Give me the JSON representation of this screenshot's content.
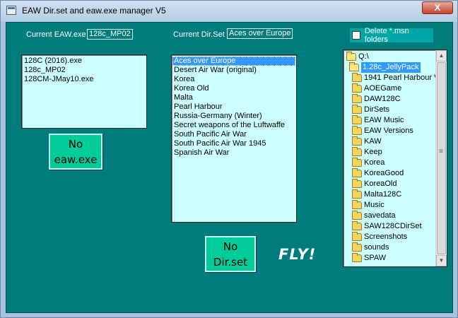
{
  "window": {
    "title": "EAW Dir.set and eaw.exe manager V5",
    "close_label": "X"
  },
  "current_exe": {
    "label": "Current EAW.exe",
    "value": "128c_MP02"
  },
  "current_dirset": {
    "label": "Current Dir.Set",
    "value": "Aces over Europe"
  },
  "delete_msn": {
    "label": "Delete *.msn folders",
    "checked": false
  },
  "exe_list": {
    "items": [
      "128C (2016).exe",
      "128c_MP02",
      "128CM-JMay10.exe"
    ]
  },
  "dirset_list": {
    "selected_index": 0,
    "items": [
      "Aces over Europe",
      "Desert Air War (original)",
      "Korea",
      "Korea Old",
      "Malta",
      "Pearl Harbour",
      "Russia-Germany (Winter)",
      "Secret weapons of the Luftwaffe",
      "South Pacific Air War",
      "South Pacific Air War 1945",
      "Spanish Air War"
    ]
  },
  "buttons": {
    "no_exe_line1": "No",
    "no_exe_line2": "eaw.exe",
    "no_dirset_line1": "No",
    "no_dirset_line2": "Dir.set",
    "fly": "FLY!"
  },
  "folder_tree": {
    "root": "Q:\\",
    "selected": "1.28c_JellyPack",
    "children": [
      "1941 Pearl Harbour V",
      "AOEGame",
      "DAW128C",
      "DirSets",
      "EAW Music",
      "EAW Versions",
      "KAW",
      "Keep",
      "Korea",
      "KoreaGood",
      "KoreaOld",
      "Malta128C",
      "Music",
      "savedata",
      "SAW128CDirSet",
      "Screenshots",
      "sounds",
      "SPAW"
    ]
  },
  "icons": {
    "app": "app-window-icon",
    "folder": "folder-icon",
    "scroll_up": "scroll-up-arrow-icon",
    "scroll_down": "scroll-down-arrow-icon"
  }
}
